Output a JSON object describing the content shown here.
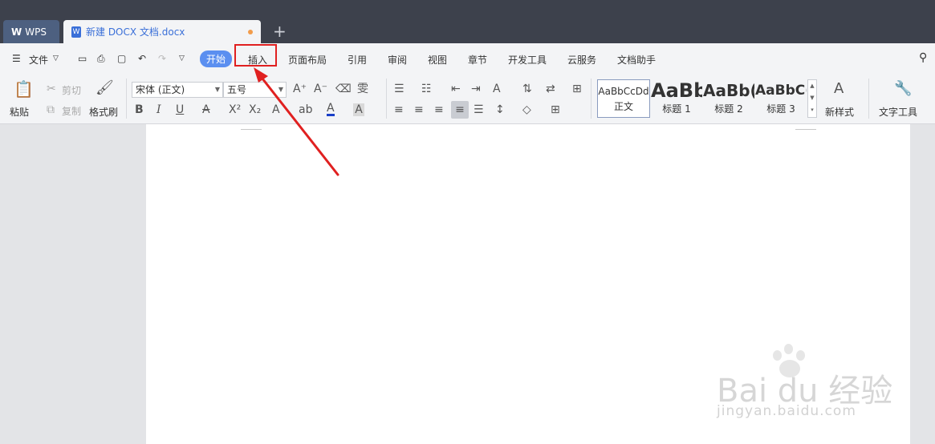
{
  "tabs": {
    "wps": {
      "label": "WPS"
    },
    "doc": {
      "label": "新建 DOCX 文档.docx"
    },
    "new": "+"
  },
  "menu": {
    "file": "文件",
    "items": [
      "开始",
      "插入",
      "页面布局",
      "引用",
      "审阅",
      "视图",
      "章节",
      "开发工具",
      "云服务",
      "文档助手"
    ],
    "active": "开始"
  },
  "ribbon": {
    "paste": "粘贴",
    "cut": "剪切",
    "copy": "复制",
    "format_painter": "格式刷",
    "font_name": "宋体 (正文)",
    "font_size": "五号",
    "styles": [
      {
        "preview": "AaBbCcDd",
        "caption": "正文"
      },
      {
        "preview": "AaBb",
        "caption": "标题 1"
      },
      {
        "preview": "AaBb(",
        "caption": "标题 2"
      },
      {
        "preview": "AaBbC(",
        "caption": "标题 3"
      }
    ],
    "new_style": "新样式",
    "text_tools": "文字工具"
  },
  "watermark": {
    "brand": "Bai du 经验",
    "url": "jingyan.baidu.com"
  },
  "colors": {
    "titlebar": "#3d414c",
    "accent": "#5b8ff0",
    "highlight": "#e02020"
  }
}
